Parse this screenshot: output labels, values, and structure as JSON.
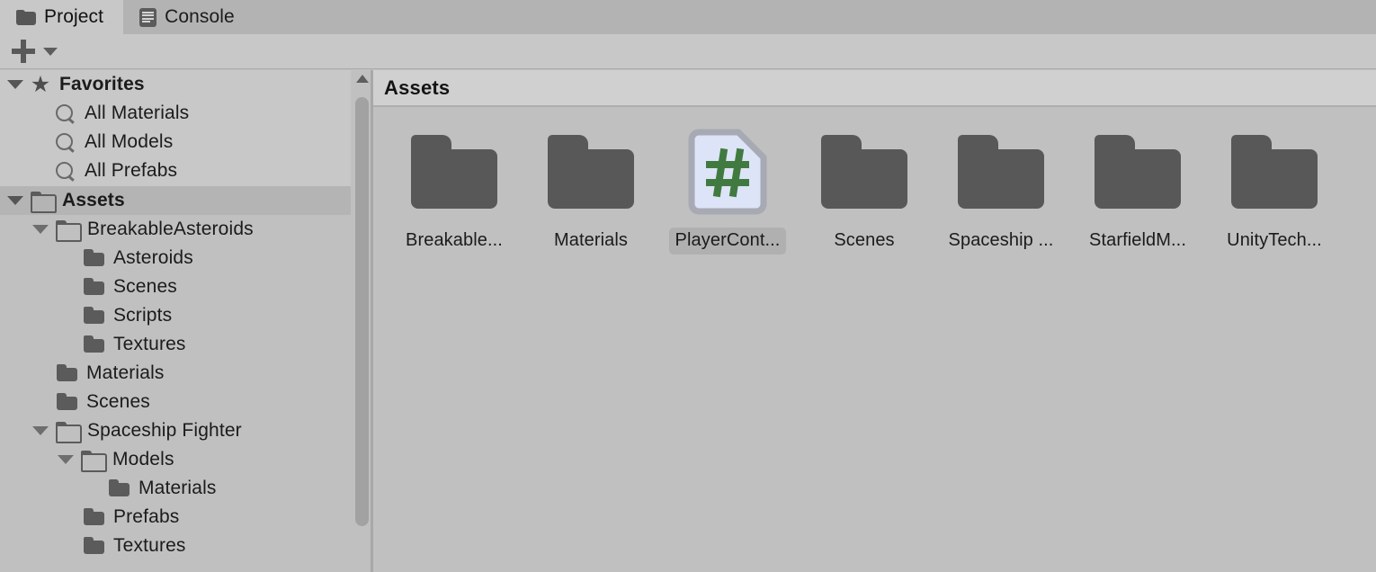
{
  "window": {
    "tabs": [
      {
        "label": "Project",
        "icon": "folder-icon",
        "active": true
      },
      {
        "label": "Console",
        "icon": "console-icon",
        "active": false
      }
    ]
  },
  "toolbar": {
    "create_label": "+",
    "create_icon": "plus-icon",
    "dropdown_icon": "chevron-down-icon"
  },
  "sidebar": {
    "favorites": {
      "label": "Favorites",
      "icon": "star-icon",
      "expanded": true,
      "items": [
        {
          "label": "All Materials",
          "icon": "search-icon"
        },
        {
          "label": "All Models",
          "icon": "search-icon"
        },
        {
          "label": "All Prefabs",
          "icon": "search-icon"
        }
      ]
    },
    "assets": {
      "label": "Assets",
      "icon": "folder-open-icon",
      "expanded": true,
      "selected": true,
      "items": [
        {
          "label": "BreakableAsteroids",
          "icon": "folder-open-icon",
          "depth": 1,
          "expanded": true
        },
        {
          "label": "Asteroids",
          "icon": "folder-closed-icon",
          "depth": 2,
          "expanded": null
        },
        {
          "label": "Scenes",
          "icon": "folder-closed-icon",
          "depth": 2,
          "expanded": null
        },
        {
          "label": "Scripts",
          "icon": "folder-closed-icon",
          "depth": 2,
          "expanded": null
        },
        {
          "label": "Textures",
          "icon": "folder-closed-icon",
          "depth": 2,
          "expanded": null
        },
        {
          "label": "Materials",
          "icon": "folder-closed-icon",
          "depth": 1,
          "expanded": null
        },
        {
          "label": "Scenes",
          "icon": "folder-closed-icon",
          "depth": 1,
          "expanded": null
        },
        {
          "label": "Spaceship Fighter",
          "icon": "folder-open-icon",
          "depth": 1,
          "expanded": true
        },
        {
          "label": "Models",
          "icon": "folder-open-icon",
          "depth": 2,
          "expanded": true
        },
        {
          "label": "Materials",
          "icon": "folder-closed-icon",
          "depth": 3,
          "expanded": null
        },
        {
          "label": "Prefabs",
          "icon": "folder-closed-icon",
          "depth": 2,
          "expanded": null
        },
        {
          "label": "Textures",
          "icon": "folder-closed-icon",
          "depth": 2,
          "expanded": null
        }
      ]
    },
    "scrollbar": {
      "up_arrow_icon": "arrow-up-icon"
    }
  },
  "content": {
    "breadcrumb": "Assets",
    "items": [
      {
        "label": "Breakable...",
        "type": "folder",
        "selected": false
      },
      {
        "label": "Materials",
        "type": "folder",
        "selected": false
      },
      {
        "label": "PlayerCont...",
        "type": "csharp-script",
        "selected": true
      },
      {
        "label": "Scenes",
        "type": "folder",
        "selected": false
      },
      {
        "label": "Spaceship ...",
        "type": "folder",
        "selected": false
      },
      {
        "label": "StarfieldM...",
        "type": "folder",
        "selected": false
      },
      {
        "label": "UnityTech...",
        "type": "folder",
        "selected": false
      }
    ]
  },
  "colors": {
    "tabbar_bg": "#b3b3b3",
    "active_tab_bg": "#c8c8c8",
    "toolbar_bg": "#c8c8c8",
    "pane_bg": "#c0c0c0",
    "favorites_bg": "#c8c8c8",
    "selection_bg": "#b4b4b4",
    "breadcrumb_bg": "#d0d0d0",
    "folder_icon": "#585858",
    "csharp_green": "#417a41",
    "csharp_page": "#dde4f7",
    "csharp_border": "#a7aab3",
    "scrollbar_thumb": "#a2a2a2",
    "text": "#1b1b1b"
  }
}
